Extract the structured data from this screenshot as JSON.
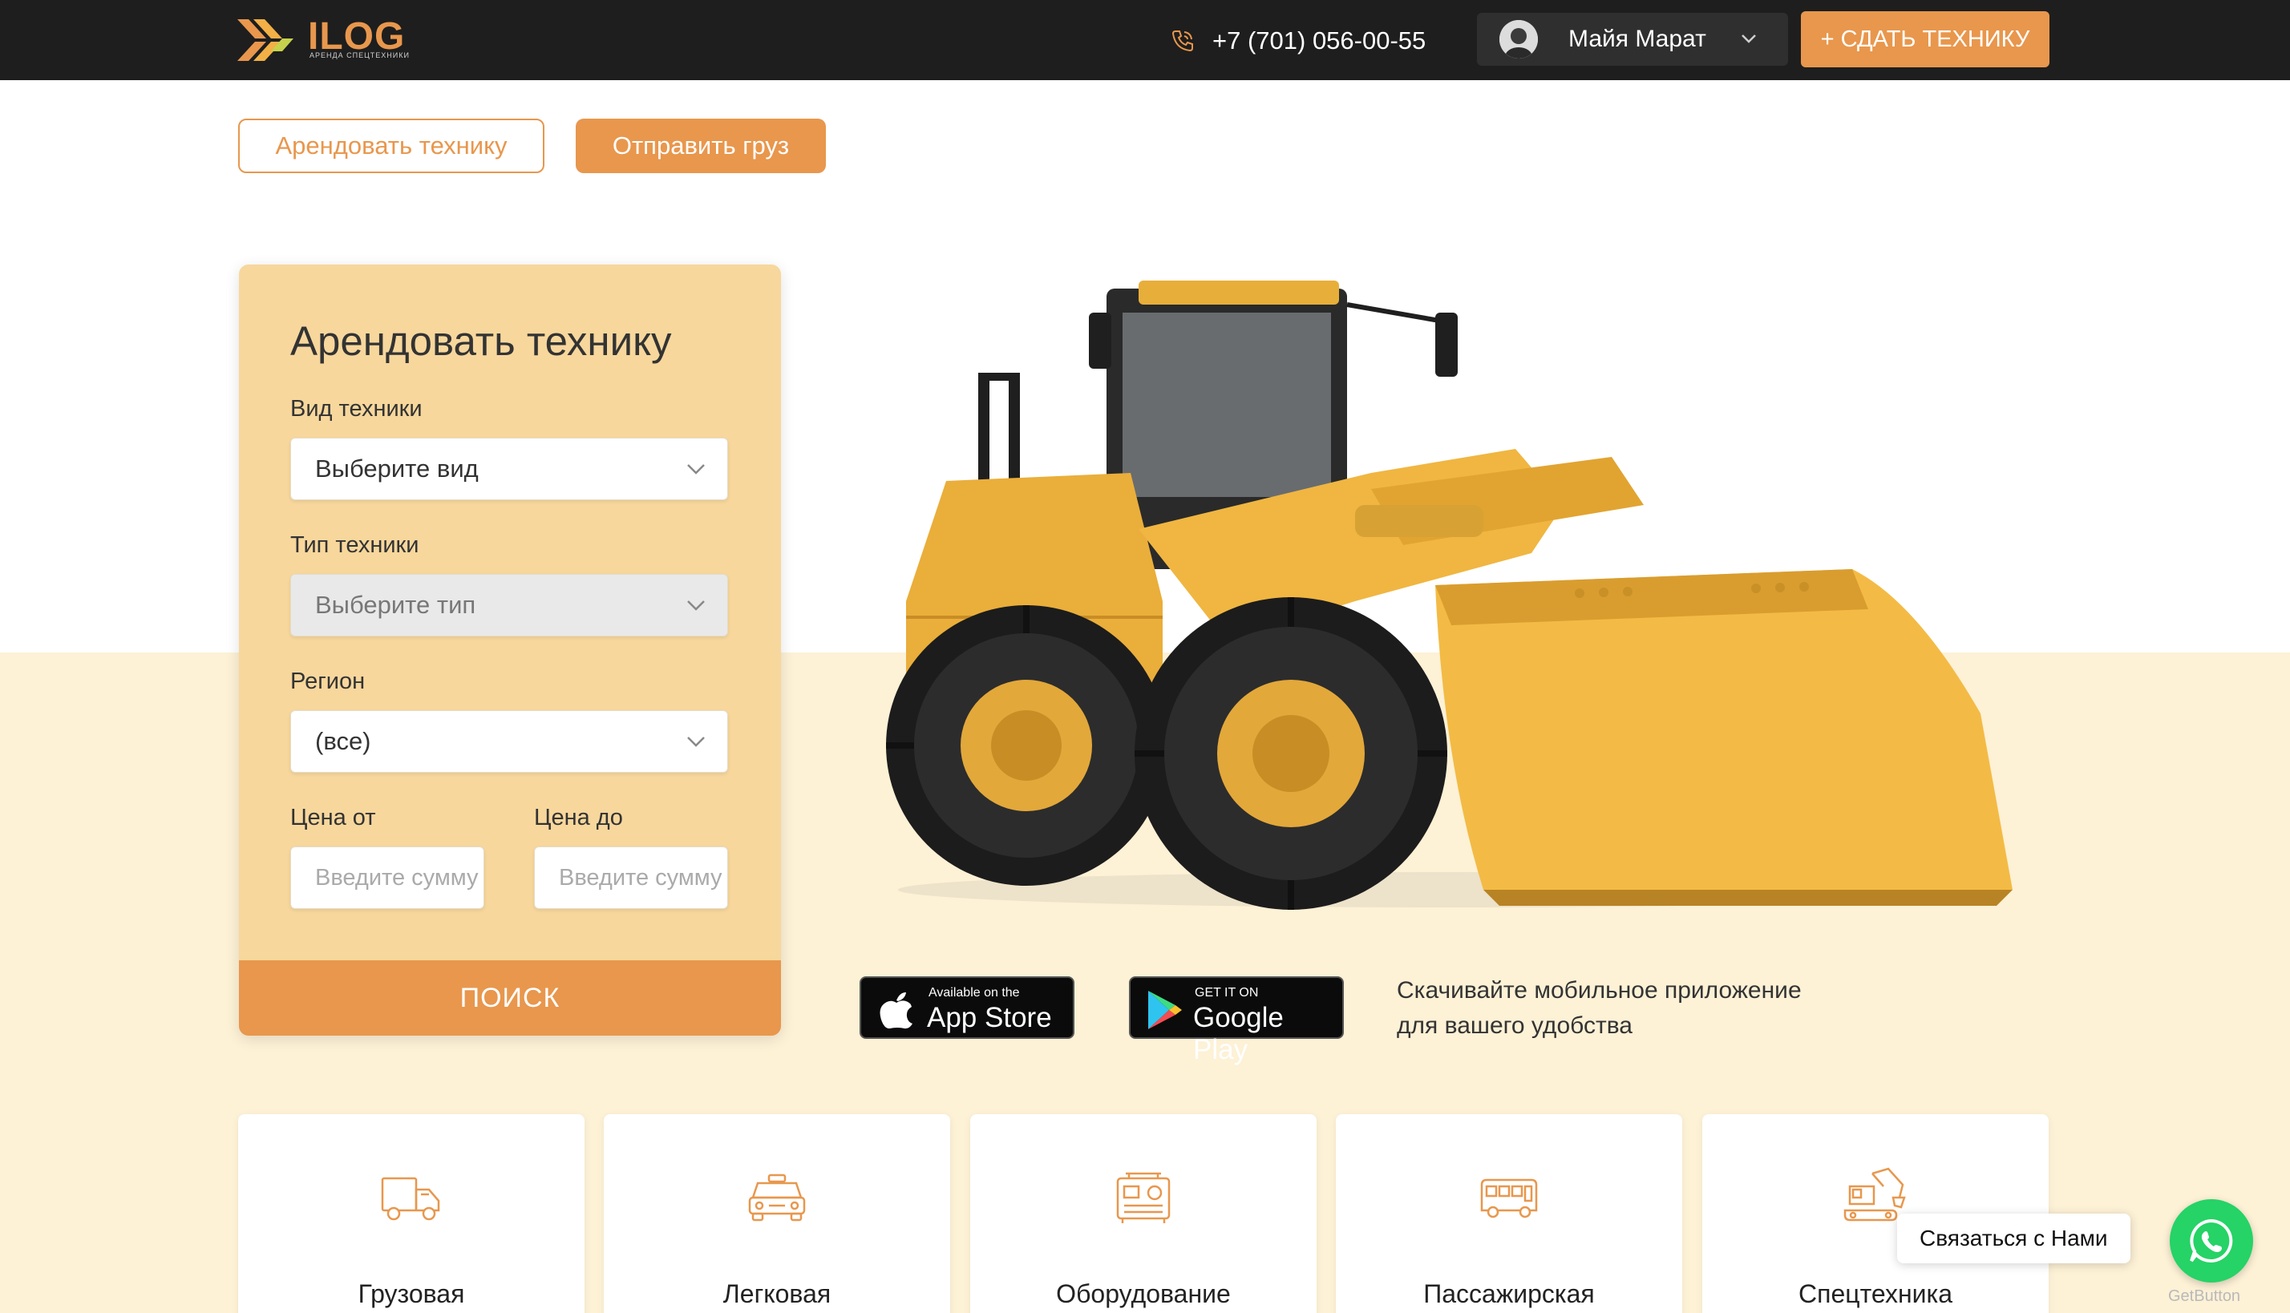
{
  "header": {
    "logo_text": "ILOG",
    "logo_subtitle": "АРЕНДА СПЕЦТЕХНИКИ",
    "phone": "+7 (701) 056-00-55",
    "user_name": "Майя Марат",
    "add_button": "+ СДАТЬ ТЕХНИКУ"
  },
  "tabs": {
    "rent": "Арендовать технику",
    "send_cargo": "Отправить груз"
  },
  "rent_form": {
    "title": "Арендовать технику",
    "kind_label": "Вид техники",
    "kind_value": "Выберите вид",
    "type_label": "Тип техники",
    "type_value": "Выберите тип",
    "region_label": "Регион",
    "region_value": "(все)",
    "price_from_label": "Цена от",
    "price_from_placeholder": "Введите сумму",
    "price_to_label": "Цена до",
    "price_to_placeholder": "Введите сумму",
    "search_button": "ПОИСК"
  },
  "apps": {
    "appstore_small": "Available on the",
    "appstore_big": "App Store",
    "googleplay_small": "GET IT ON",
    "googleplay_big": "Google Play",
    "text_line1": "Скачивайте мобильное приложение",
    "text_line2": "для вашего удобства"
  },
  "categories": [
    {
      "label": "Грузовая",
      "icon": "truck-icon"
    },
    {
      "label": "Легковая",
      "icon": "car-icon"
    },
    {
      "label": "Оборудование",
      "icon": "generator-icon"
    },
    {
      "label": "Пассажирская",
      "icon": "bus-icon"
    },
    {
      "label": "Спецтехника",
      "icon": "excavator-icon"
    }
  ],
  "contact": {
    "bubble": "Связаться с Нами",
    "provider": "GetButton"
  },
  "colors": {
    "accent": "#e8974d",
    "header_bg": "#1e1e1e",
    "card_bg": "#f7d79c",
    "band_bg": "#fdf1d6",
    "whatsapp": "#25d366"
  }
}
